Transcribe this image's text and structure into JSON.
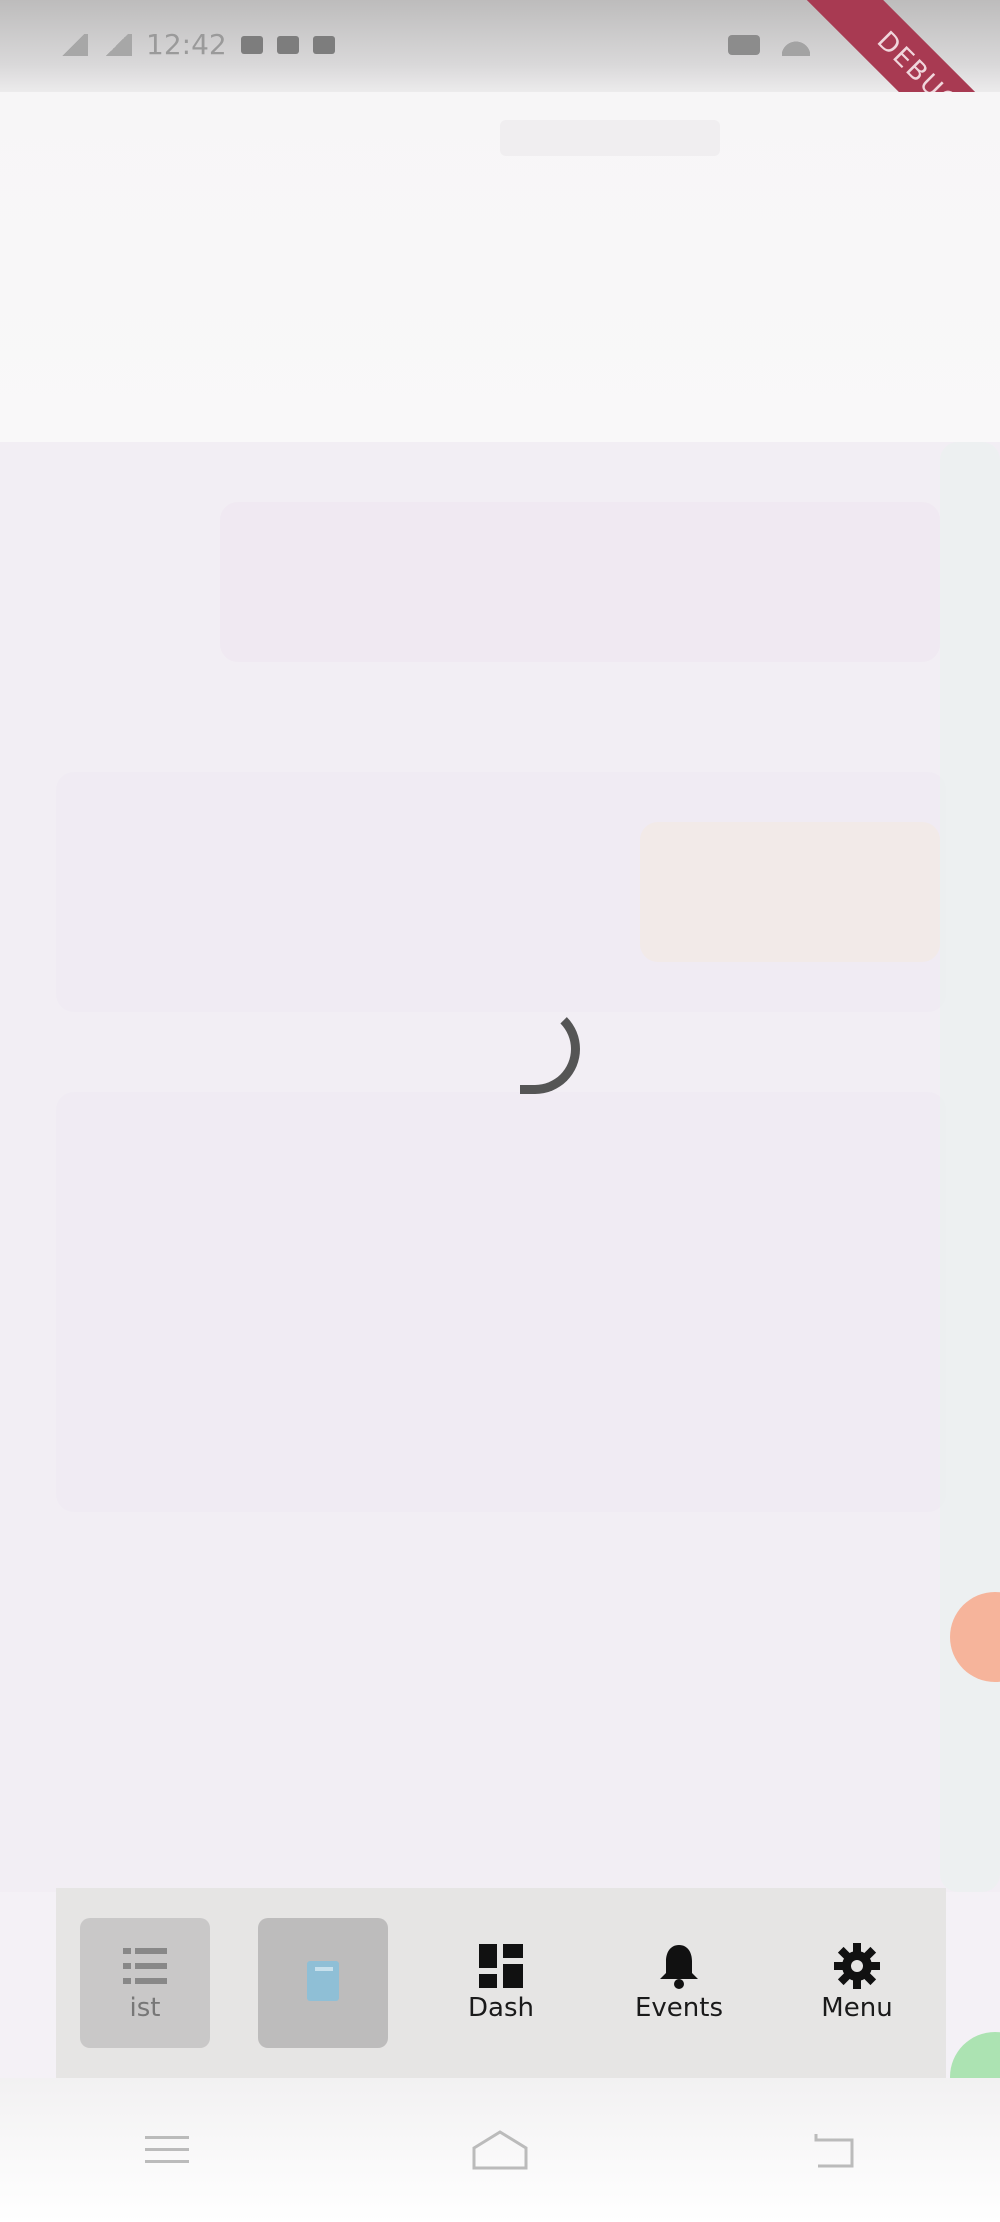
{
  "status_bar": {
    "time": "12:42"
  },
  "debug_banner": "DEBUG",
  "nav": {
    "items": [
      {
        "label": "ist",
        "icon": "list-icon"
      },
      {
        "label": "",
        "icon": "book-icon"
      },
      {
        "label": "Dash",
        "icon": "dashboard-icon"
      },
      {
        "label": "Events",
        "icon": "bell-icon"
      },
      {
        "label": "Menu",
        "icon": "gear-icon"
      }
    ]
  },
  "colors": {
    "debug": "#a83a52",
    "nav_background": "#e6e5e4",
    "accent_orange": "#f7a98c",
    "accent_green": "#9fe0a6"
  }
}
